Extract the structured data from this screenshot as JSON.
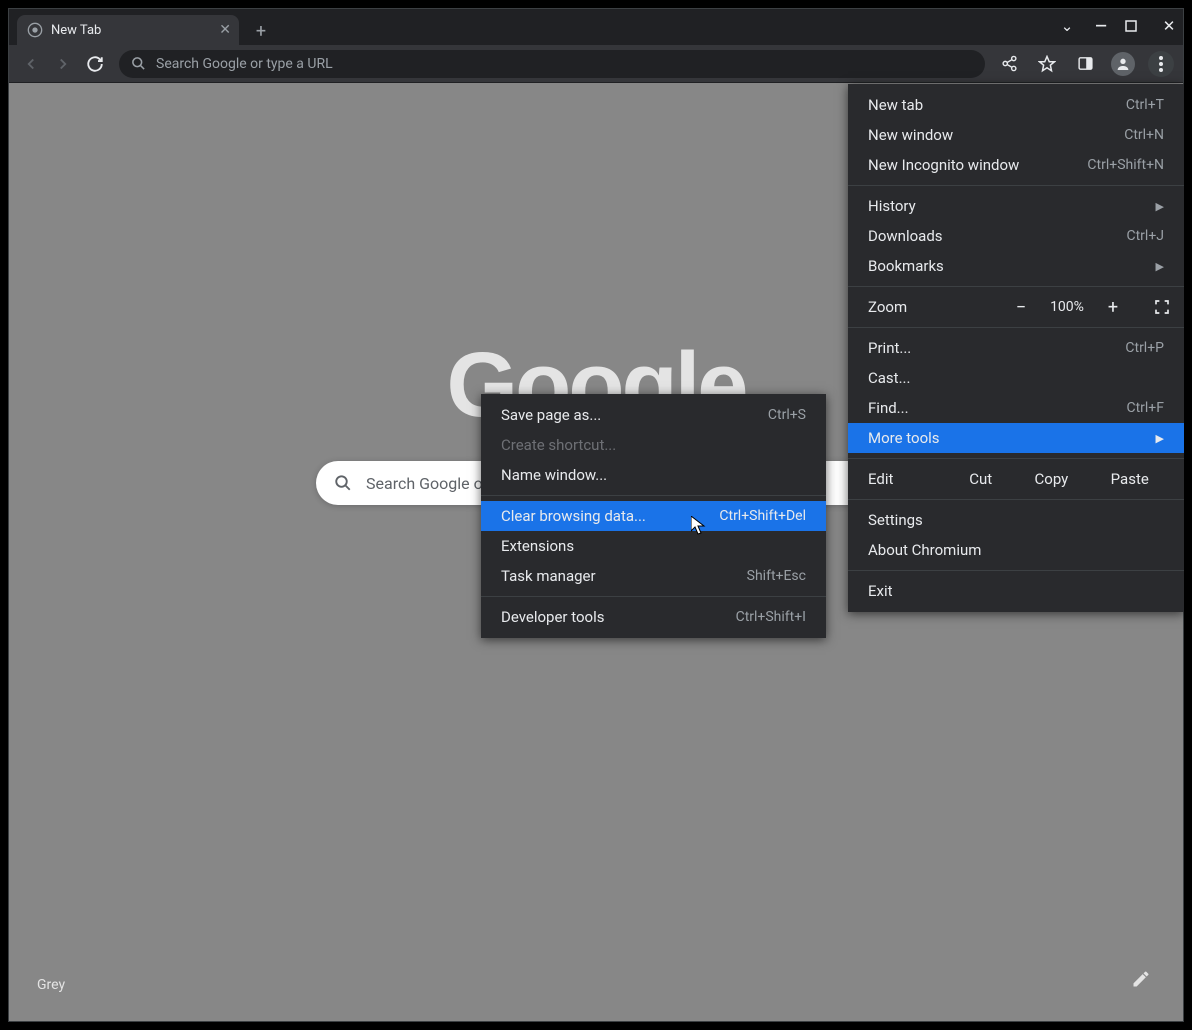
{
  "tab": {
    "title": "New Tab"
  },
  "omnibox": {
    "placeholder": "Search Google or type a URL"
  },
  "page": {
    "logo_text": "Google",
    "search_placeholder": "Search Google or type a URL",
    "theme_name": "Grey"
  },
  "menu": {
    "new_tab": {
      "label": "New tab",
      "shortcut": "Ctrl+T"
    },
    "new_window": {
      "label": "New window",
      "shortcut": "Ctrl+N"
    },
    "new_incognito": {
      "label": "New Incognito window",
      "shortcut": "Ctrl+Shift+N"
    },
    "history": {
      "label": "History"
    },
    "downloads": {
      "label": "Downloads",
      "shortcut": "Ctrl+J"
    },
    "bookmarks": {
      "label": "Bookmarks"
    },
    "zoom": {
      "label": "Zoom",
      "value": "100%",
      "minus": "−",
      "plus": "+"
    },
    "print": {
      "label": "Print...",
      "shortcut": "Ctrl+P"
    },
    "cast": {
      "label": "Cast..."
    },
    "find": {
      "label": "Find...",
      "shortcut": "Ctrl+F"
    },
    "more_tools": {
      "label": "More tools"
    },
    "edit": {
      "label": "Edit",
      "cut": "Cut",
      "copy": "Copy",
      "paste": "Paste"
    },
    "settings": {
      "label": "Settings"
    },
    "about": {
      "label": "About Chromium"
    },
    "exit": {
      "label": "Exit"
    }
  },
  "submenu": {
    "save_page": {
      "label": "Save page as...",
      "shortcut": "Ctrl+S"
    },
    "create_shortcut": {
      "label": "Create shortcut..."
    },
    "name_window": {
      "label": "Name window..."
    },
    "clear_data": {
      "label": "Clear browsing data...",
      "shortcut": "Ctrl+Shift+Del"
    },
    "extensions": {
      "label": "Extensions"
    },
    "task_manager": {
      "label": "Task manager",
      "shortcut": "Shift+Esc"
    },
    "dev_tools": {
      "label": "Developer tools",
      "shortcut": "Ctrl+Shift+I"
    }
  }
}
